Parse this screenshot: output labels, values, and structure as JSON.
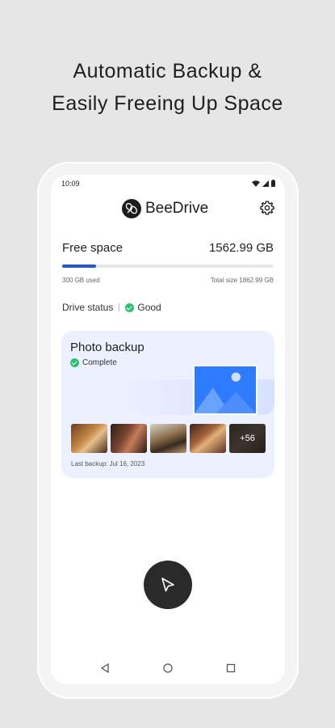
{
  "promo": {
    "line1": "Automatic Backup &",
    "line2": "Easily Freeing Up Space"
  },
  "status_bar": {
    "time": "10:09"
  },
  "header": {
    "brand_name": "BeeDrive",
    "logo_icon": "beedrive-logo-icon",
    "settings_icon": "gear-icon"
  },
  "storage": {
    "free_label": "Free space",
    "free_value": "1562.99 GB",
    "used_text": "300 GB used",
    "total_text": "Total size 1862.99 GB",
    "used_fraction": 0.16,
    "bar_color": "#2058d6"
  },
  "drive_status": {
    "label": "Drive status",
    "value": "Good",
    "status_color": "#2fbf71"
  },
  "photo_backup": {
    "title": "Photo backup",
    "status": "Complete",
    "more_count": "+56",
    "last_backup": "Last backup: Jul 16, 2023",
    "card_color": "#edf1ff",
    "illustration_color": "#2f7bff"
  },
  "fab": {
    "icon": "cursor-arrow-icon"
  },
  "nav": {
    "back_icon": "back-triangle-icon",
    "home_icon": "home-circle-icon",
    "recents_icon": "recents-square-icon"
  }
}
